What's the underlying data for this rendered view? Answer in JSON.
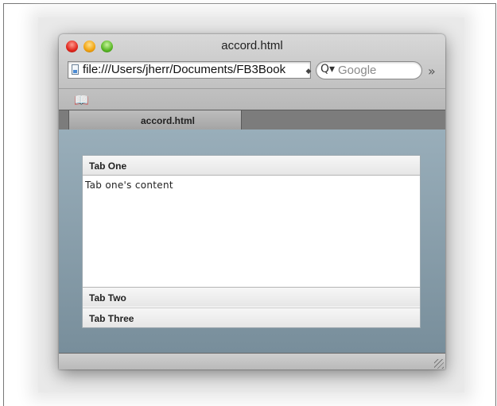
{
  "window": {
    "title": "accord.html"
  },
  "toolbar": {
    "url": "file:///Users/jherr/Documents/FB3Book",
    "search_placeholder": "Google",
    "overflow_glyph": "»"
  },
  "icons": {
    "page": "page-icon",
    "search": "search-icon",
    "bookmarks": "bookmarks-book-icon",
    "overflow": "chevron-double-right-icon",
    "resize": "resize-grip-icon"
  },
  "tabs": [
    {
      "label": "accord.html",
      "active": true
    }
  ],
  "accordion": {
    "sections": [
      {
        "header": "Tab One",
        "content": "Tab one's content",
        "expanded": true
      },
      {
        "header": "Tab Two",
        "expanded": false
      },
      {
        "header": "Tab Three",
        "expanded": false
      }
    ]
  },
  "colors": {
    "content_background": "#8fa3af",
    "close_button": "#e0261c",
    "minimize_button": "#f1a20f",
    "zoom_button": "#58b624"
  }
}
